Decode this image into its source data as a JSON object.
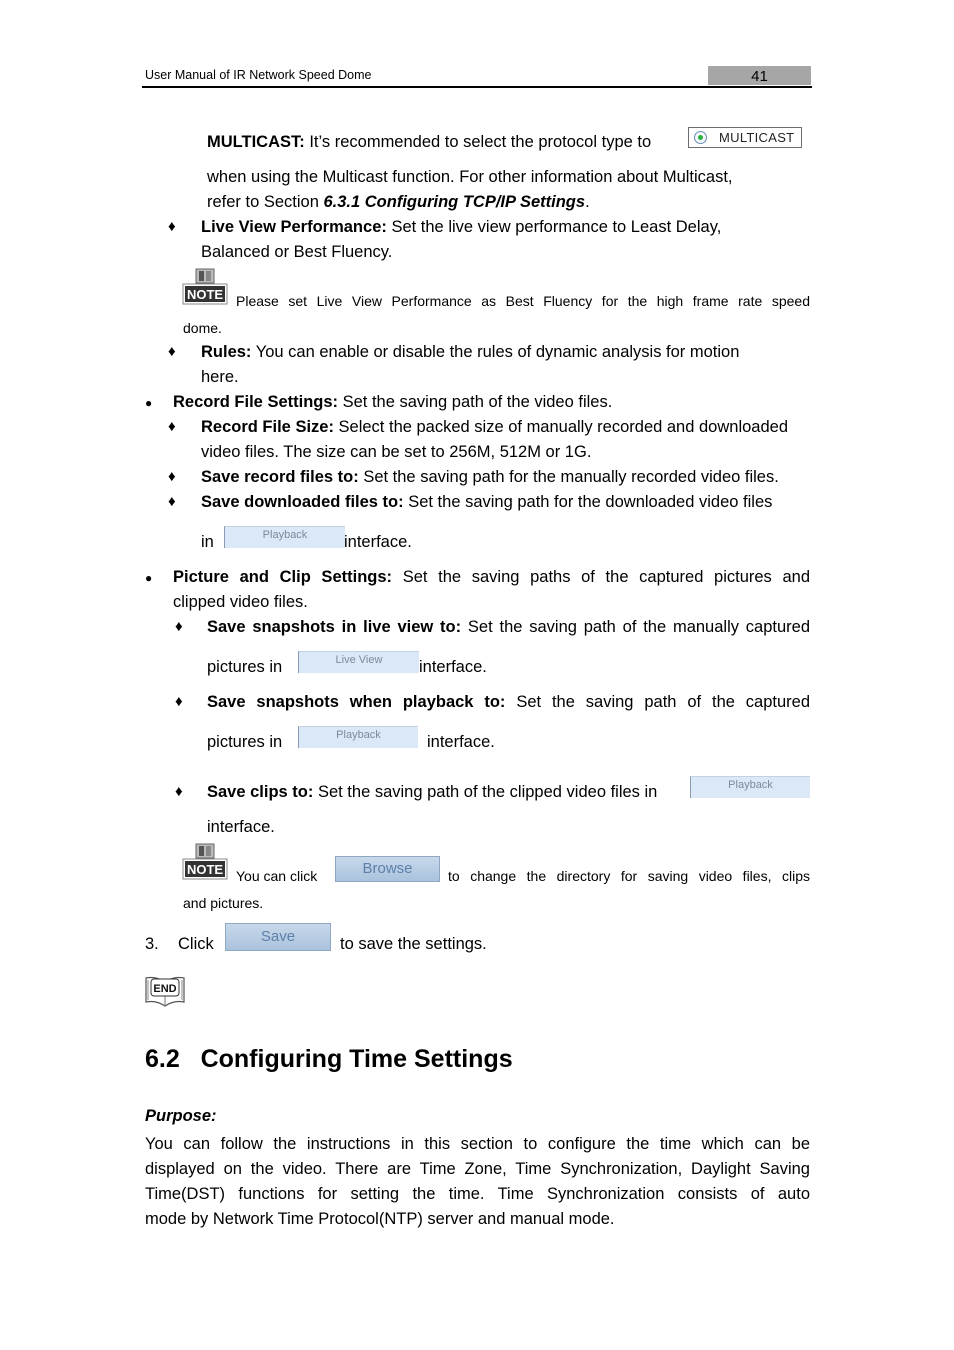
{
  "header": {
    "title": "User Manual of IR Network Speed Dome",
    "page_number": "41"
  },
  "multicast": {
    "label": "MULTICAST:",
    "text1": " It’s recommended to select the protocol type to",
    "radio_label": "MULTICAST",
    "text2": "when using the Multicast function. For other information about Multicast,",
    "text3_prefix": "refer to Section ",
    "text3_ref": "6.3.1 Configuring TCP/IP Settings",
    "text3_suffix": "."
  },
  "live_view_performance": {
    "label": "Live View Performance:",
    "text1": " Set the live view performance to Least Delay,",
    "text2": "Balanced or Best Fluency."
  },
  "note1": {
    "icon_text": "NOTE",
    "text1": "Please set Live View Performance as Best Fluency for the high frame rate speed",
    "text2": "dome."
  },
  "rules": {
    "label": "Rules:",
    "text1": " You can enable or disable the rules of dynamic analysis for motion",
    "text2": "here."
  },
  "record_file_settings": {
    "label": "Record File Settings:",
    "text": " Set the saving path of the video files.",
    "items": [
      {
        "label": "Record File Size:",
        "text1": " Select the packed size of manually recorded and downloaded",
        "text2": "video files. The size can be set to 256M, 512M or 1G."
      },
      {
        "label": "Save record files to:",
        "text1": " Set the saving path for the manually recorded video files."
      },
      {
        "label": "Save downloaded files to:",
        "text1": " Set the saving path for the downloaded video files",
        "pre": "in",
        "button": "Playback",
        "post": "interface."
      }
    ]
  },
  "picture_clip_settings": {
    "label": "Picture and Clip Settings:",
    "text1": " Set the saving paths of the captured pictures and",
    "text2": "clipped video files.",
    "items": [
      {
        "label": "Save snapshots in live view to:",
        "text1": " Set the saving path of the manually captured",
        "pre": "pictures in",
        "button": "Live View",
        "post": "interface."
      },
      {
        "label": "Save snapshots when playback to:",
        "text1": " Set the saving path of the captured",
        "pre": "pictures in",
        "button": "Playback",
        "post": "interface."
      },
      {
        "label": "Save clips to:",
        "text1": " Set the saving path of the clipped video files in",
        "button": "Playback",
        "post": "interface."
      }
    ]
  },
  "note2": {
    "icon_text": "NOTE",
    "pre": "You can click",
    "button": "Browse",
    "post": "to change the directory for saving video files, clips",
    "text2": "and pictures."
  },
  "step3": {
    "number": "3.",
    "pre": "Click",
    "button": "Save",
    "post": "to save the settings."
  },
  "end_icon_text": "END",
  "section": {
    "heading": "6.2   Configuring Time Settings",
    "purpose_label": "Purpose:",
    "paragraph_lines": [
      "You can follow the instructions in this section to configure the time which can be",
      "displayed on the video. There are Time Zone, Time Synchronization, Daylight Saving",
      "Time(DST) functions for setting the time. Time Synchronization consists of auto",
      "mode by Network Time Protocol(NTP) server and manual mode."
    ]
  }
}
